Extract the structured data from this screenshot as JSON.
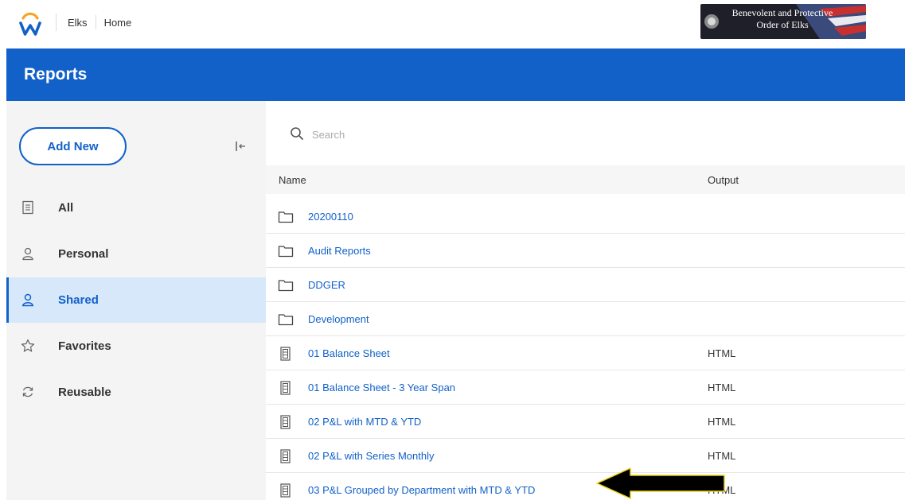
{
  "topbar": {
    "breadcrumbs": [
      "Elks",
      "Home"
    ],
    "banner_text": [
      "Benevolent and Protective",
      "Order of Elks"
    ]
  },
  "header": {
    "title": "Reports"
  },
  "sidebar": {
    "add_new_label": "Add New",
    "collapse_icon": "collapse-left-icon",
    "items": [
      {
        "label": "All",
        "icon": "document-icon",
        "active": false
      },
      {
        "label": "Personal",
        "icon": "person-icon",
        "active": false
      },
      {
        "label": "Shared",
        "icon": "shared-person-icon",
        "active": true
      },
      {
        "label": "Favorites",
        "icon": "star-icon",
        "active": false
      },
      {
        "label": "Reusable",
        "icon": "refresh-icon",
        "active": false
      }
    ]
  },
  "main": {
    "search": {
      "placeholder": "Search"
    },
    "columns": {
      "name": "Name",
      "output": "Output"
    },
    "rows": [
      {
        "type": "folder",
        "name": "20200110",
        "output": ""
      },
      {
        "type": "folder",
        "name": "Audit Reports",
        "output": ""
      },
      {
        "type": "folder",
        "name": "DDGER",
        "output": ""
      },
      {
        "type": "folder",
        "name": "Development",
        "output": ""
      },
      {
        "type": "report",
        "name": "01 Balance Sheet",
        "output": "HTML"
      },
      {
        "type": "report",
        "name": "01 Balance Sheet - 3 Year Span",
        "output": "HTML"
      },
      {
        "type": "report",
        "name": "02 P&L with MTD & YTD",
        "output": "HTML"
      },
      {
        "type": "report",
        "name": "02 P&L with Series Monthly",
        "output": "HTML"
      },
      {
        "type": "report",
        "name": "03 P&L Grouped by Department with MTD & YTD",
        "output": "HTML"
      }
    ]
  },
  "colors": {
    "brand_blue": "#1161c9",
    "logo_orange": "#f5a623",
    "sidebar_bg": "#f4f4f4",
    "active_bg": "#d8e8fb"
  }
}
